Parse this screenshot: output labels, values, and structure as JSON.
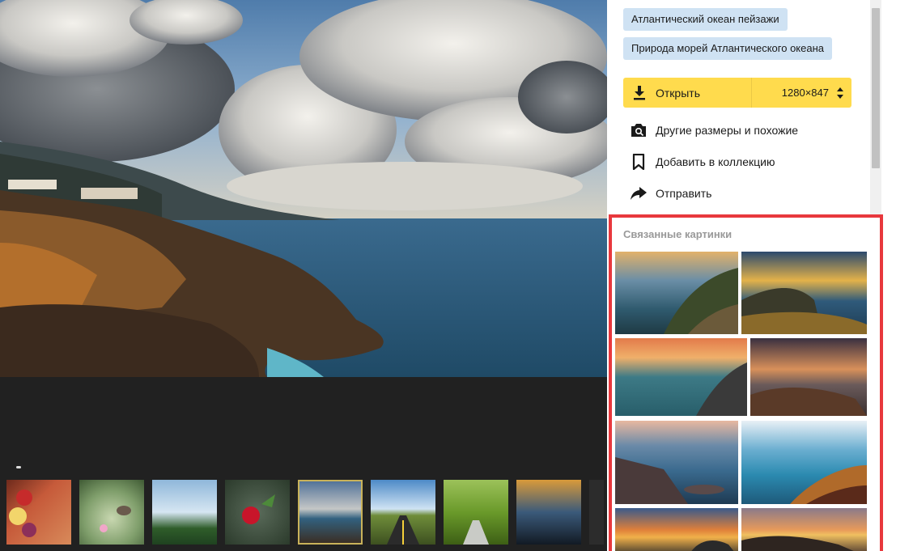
{
  "tags": [
    {
      "label": "Атлантический океан пейзажи"
    },
    {
      "label": "Природа морей Атлантического океана"
    }
  ],
  "open_button": {
    "label": "Открыть",
    "size": "1280×847"
  },
  "actions": [
    {
      "label": "Другие размеры и похожие",
      "icon": "camera-search-icon"
    },
    {
      "label": "Добавить в коллекцию",
      "icon": "bookmark-icon"
    },
    {
      "label": "Отправить",
      "icon": "share-arrow-icon"
    }
  ],
  "related": {
    "title": "Связанные картинки"
  },
  "colors": {
    "accent": "#ffdb4d",
    "tag_bg": "#cfe2f3",
    "highlight": "#e8383d",
    "dark_bg": "#212121"
  },
  "strip_thumbs": [
    "fruits",
    "bird",
    "sky-trees",
    "rose",
    "coast-clouds",
    "road",
    "tree-alley",
    "rain-glass"
  ]
}
